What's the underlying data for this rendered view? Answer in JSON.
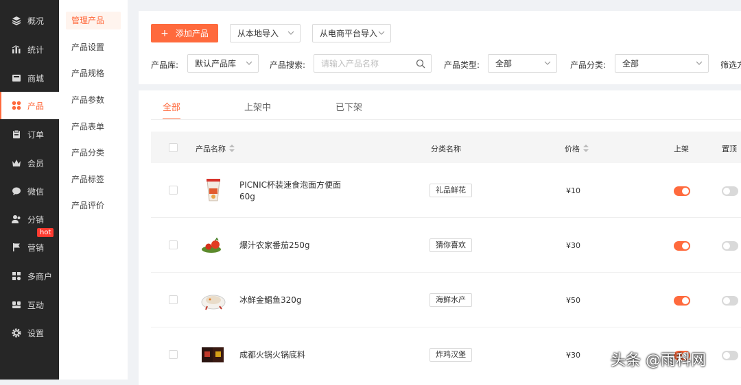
{
  "nav": {
    "items": [
      {
        "label": "概况",
        "icon": "layers-icon"
      },
      {
        "label": "统计",
        "icon": "chart-icon"
      },
      {
        "label": "商城",
        "icon": "store-icon"
      },
      {
        "label": "产品",
        "icon": "grid-icon"
      },
      {
        "label": "订单",
        "icon": "clipboard-icon"
      },
      {
        "label": "会员",
        "icon": "crown-icon"
      },
      {
        "label": "微信",
        "icon": "chat-icon"
      },
      {
        "label": "分销",
        "icon": "users-icon"
      },
      {
        "label": "营销",
        "icon": "flag-icon"
      },
      {
        "label": "多商户",
        "icon": "multi-store-icon"
      },
      {
        "label": "互动",
        "icon": "interact-icon"
      },
      {
        "label": "设置",
        "icon": "gear-icon"
      }
    ],
    "hot_badge": "hot",
    "active": "产品"
  },
  "subnav": {
    "items": [
      "管理产品",
      "产品设置",
      "产品规格",
      "产品参数",
      "产品表单",
      "产品分类",
      "产品标签",
      "产品评价"
    ]
  },
  "toolbar": {
    "add_label": "添加产品",
    "import_local": "从本地导入",
    "import_platform": "从电商平台导入"
  },
  "filters": {
    "library_label": "产品库:",
    "library_value": "默认产品库",
    "search_label": "产品搜索:",
    "search_placeholder": "请输入产品名称",
    "type_label": "产品类型:",
    "type_value": "全部",
    "category_label": "产品分类:",
    "category_value": "全部",
    "filter_label": "筛选方"
  },
  "tabs": [
    "全部",
    "上架中",
    "已下架"
  ],
  "table": {
    "headers": {
      "name": "产品名称",
      "category": "分类名称",
      "price": "价格",
      "listed": "上架",
      "pinned": "置顶"
    },
    "rows": [
      {
        "name": "PICNIC杯装速食泡面方便面60g",
        "category": "礼品鲜花",
        "price": "¥10",
        "listed": true,
        "pinned": false
      },
      {
        "name": "爆汁农家番茄250g",
        "category": "猜你喜欢",
        "price": "¥30",
        "listed": true,
        "pinned": false
      },
      {
        "name": "冰鲜金鲳鱼320g",
        "category": "海鲜水产",
        "price": "¥50",
        "listed": true,
        "pinned": false
      },
      {
        "name": "成都火锅火锅底料",
        "category": "炸鸡汉堡",
        "price": "¥30",
        "listed": true,
        "pinned": false
      }
    ]
  },
  "watermark": "头条 @雨科网",
  "colors": {
    "accent": "#ff6a3d",
    "sidebar": "#262626"
  }
}
